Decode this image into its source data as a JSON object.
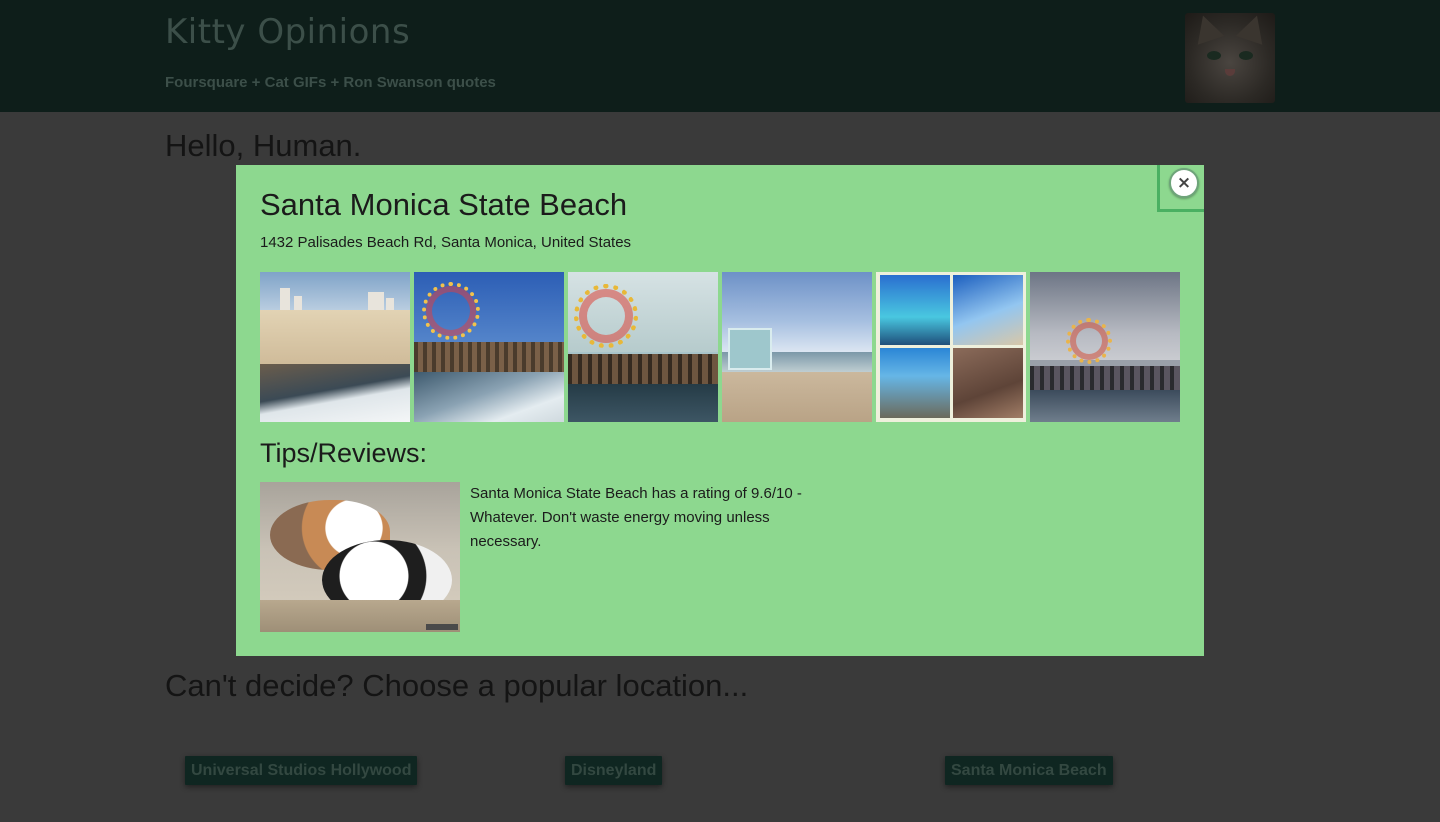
{
  "header": {
    "brand": "Kitty Opinions",
    "tagline": "Foursquare + Cat GIFs + Ron Swanson quotes",
    "avatar_alt": "cat avatar"
  },
  "main": {
    "greeting": "Hello, Human.",
    "popular_heading": "Can't decide? Choose a popular location...",
    "popular_locations": [
      {
        "label": "Universal Studios Hollywood"
      },
      {
        "label": "Disneyland"
      },
      {
        "label": "Santa Monica Beach"
      }
    ]
  },
  "modal": {
    "close_label": "×",
    "venue_name": "Santa Monica State Beach",
    "address": "1432 Palisades Beach Rd, Santa Monica, United States",
    "photos": [
      {
        "name": "beach-shore-photo"
      },
      {
        "name": "pier-ferris-wheel-photo"
      },
      {
        "name": "pier-ferris-wheel-cloudy-photo"
      },
      {
        "name": "lifeguard-tower-photo"
      },
      {
        "name": "beach-collage-photo"
      },
      {
        "name": "pier-sunset-photo"
      }
    ],
    "tips_heading": "Tips/Reviews:",
    "tip_gif_alt": "cats cuddling gif",
    "tip_text": "Santa Monica State Beach has a rating of 9.6/10 - Whatever. Don't waste energy moving unless necessary."
  },
  "colors": {
    "header_bg": "#0e1e1a",
    "overlay_bg": "#3a3a3a",
    "modal_bg": "#8dd88f",
    "button_bg": "#0f2621"
  }
}
